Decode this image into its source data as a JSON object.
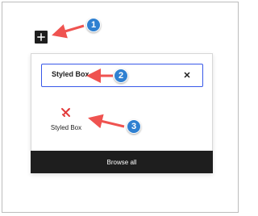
{
  "colors": {
    "accent": "#3858e9",
    "dark": "#1e1e1e",
    "arrow": "#ef5350",
    "badge": "#2f80d1",
    "icon": "#e23b3b"
  },
  "inserter": {
    "search": {
      "value": "Styled Box"
    },
    "clear_icon": "close-icon",
    "result": {
      "icon": "styled-box-icon",
      "label": "Styled Box"
    },
    "browse_all": "Browse all"
  },
  "callouts": [
    {
      "number": "1"
    },
    {
      "number": "2"
    },
    {
      "number": "3"
    }
  ]
}
